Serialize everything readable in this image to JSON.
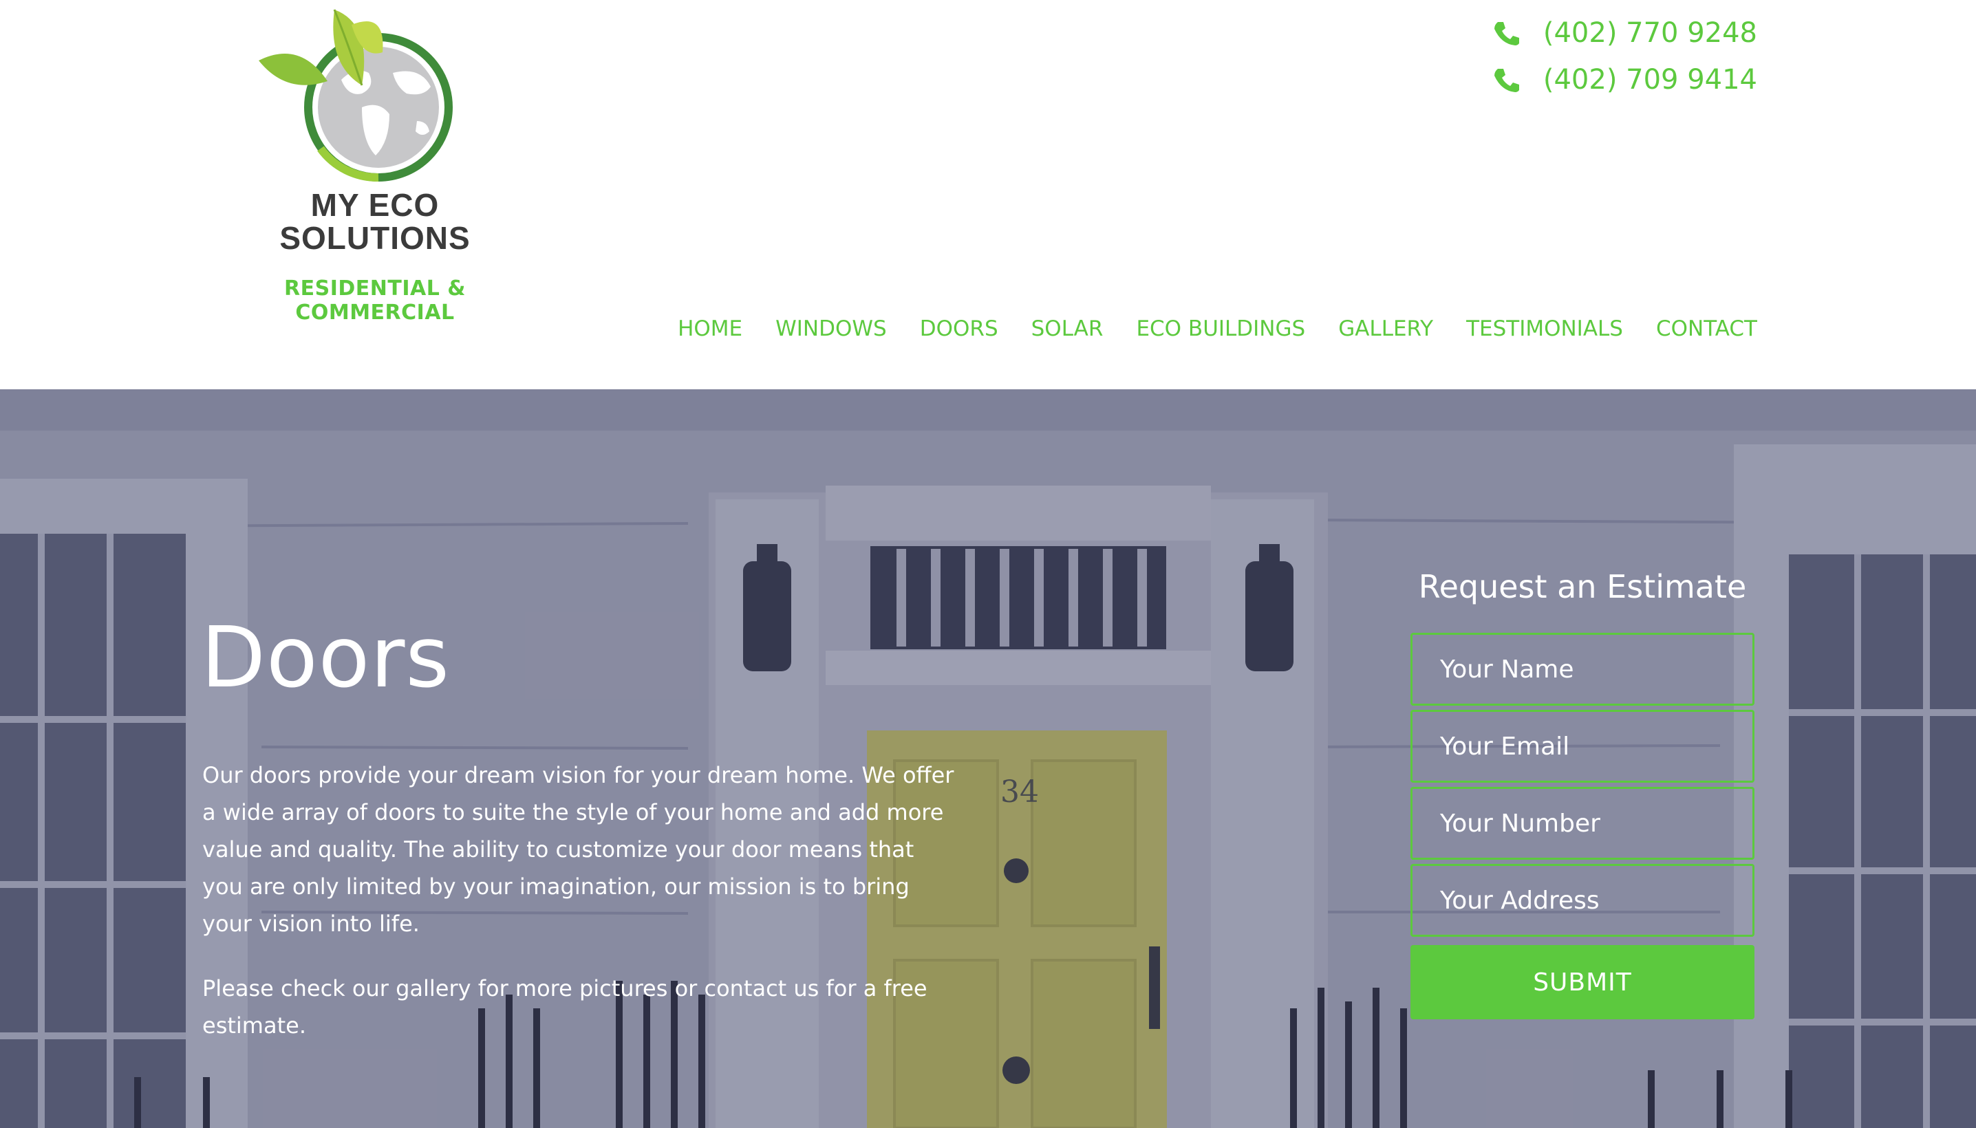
{
  "header": {
    "logo": {
      "name_line1": "MY ECO",
      "name_line2": "SOLUTIONS",
      "tagline": "RESIDENTIAL & COMMERCIAL",
      "icon": "leaf-globe-logo"
    },
    "phones": [
      {
        "icon": "phone-icon",
        "number": "(402) 770 9248"
      },
      {
        "icon": "phone-icon",
        "number": "(402) 709 9414"
      }
    ],
    "nav": [
      {
        "label": "HOME"
      },
      {
        "label": "WINDOWS"
      },
      {
        "label": "DOORS"
      },
      {
        "label": "SOLAR"
      },
      {
        "label": "ECO BUILDINGS"
      },
      {
        "label": "GALLERY"
      },
      {
        "label": "TESTIMONIALS"
      },
      {
        "label": "CONTACT"
      }
    ]
  },
  "hero": {
    "title": "Doors",
    "paragraphs": [
      "Our doors provide your dream vision for your dream home. We offer a wide array of doors to suite the style of your home and add more value and quality. The ability to customize your door means that you are only limited by your imagination, our mission is to bring your vision into life.",
      "Please check our gallery for more pictures or contact us for a free estimate."
    ],
    "door_number": "34"
  },
  "estimate_form": {
    "title": "Request an Estimate",
    "fields": [
      {
        "placeholder": "Your Name"
      },
      {
        "placeholder": "Your Email"
      },
      {
        "placeholder": "Your Number"
      },
      {
        "placeholder": "Your Address"
      }
    ],
    "submit_label": "SUBMIT"
  },
  "colors": {
    "accent_green": "#5cc93e",
    "logo_text": "#3b3b3b",
    "hero_overlay": "#464a6e",
    "door_yellow": "#d9d35a"
  }
}
